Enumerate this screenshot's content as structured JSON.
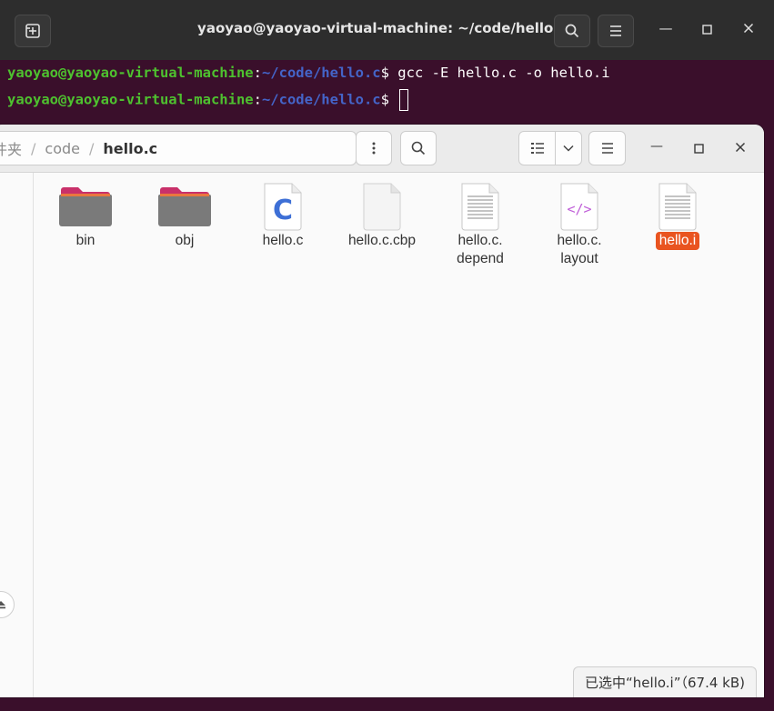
{
  "terminal": {
    "title": "yaoyao@yaoyao-virtual-machine: ~/code/hello.c",
    "lines": [
      {
        "user": "yaoyao@yaoyao-virtual-machine",
        "colon": ":",
        "path": "~/code/hello.c",
        "prompt": "$ ",
        "command": "gcc -E hello.c -o hello.i"
      },
      {
        "user": "yaoyao@yaoyao-virtual-machine",
        "colon": ":",
        "path": "~/code/hello.c",
        "prompt": "$ ",
        "command": ""
      }
    ],
    "colors": {
      "background": "#3a0f2b",
      "user": "#4ec12f",
      "path": "#4464c8"
    }
  },
  "files": {
    "path": {
      "partial": "件夹",
      "sep1": "/",
      "code": "code",
      "sep2": "/",
      "current": "hello.c"
    },
    "items": [
      {
        "label": "bin",
        "icon": "folder-icon"
      },
      {
        "label": "obj",
        "icon": "folder-icon"
      },
      {
        "label": "hello.c",
        "icon": "c-source-file-icon"
      },
      {
        "label": "hello.c.cbp",
        "icon": "generic-file-icon"
      },
      {
        "label": "hello.c.\ndepend",
        "icon": "text-file-icon"
      },
      {
        "label": "hello.c.\nlayout",
        "icon": "xml-file-icon"
      },
      {
        "label": "hello.i",
        "icon": "text-file-icon",
        "selected": true
      }
    ],
    "status": "已选中“hello.i”（67.4 kB)",
    "colors": {
      "selection": "#e95420",
      "folder": "#7a7a7a",
      "folder_tab": "#c9306a",
      "c_letter": "#3d6fd6",
      "xml": "#c060d8"
    }
  }
}
